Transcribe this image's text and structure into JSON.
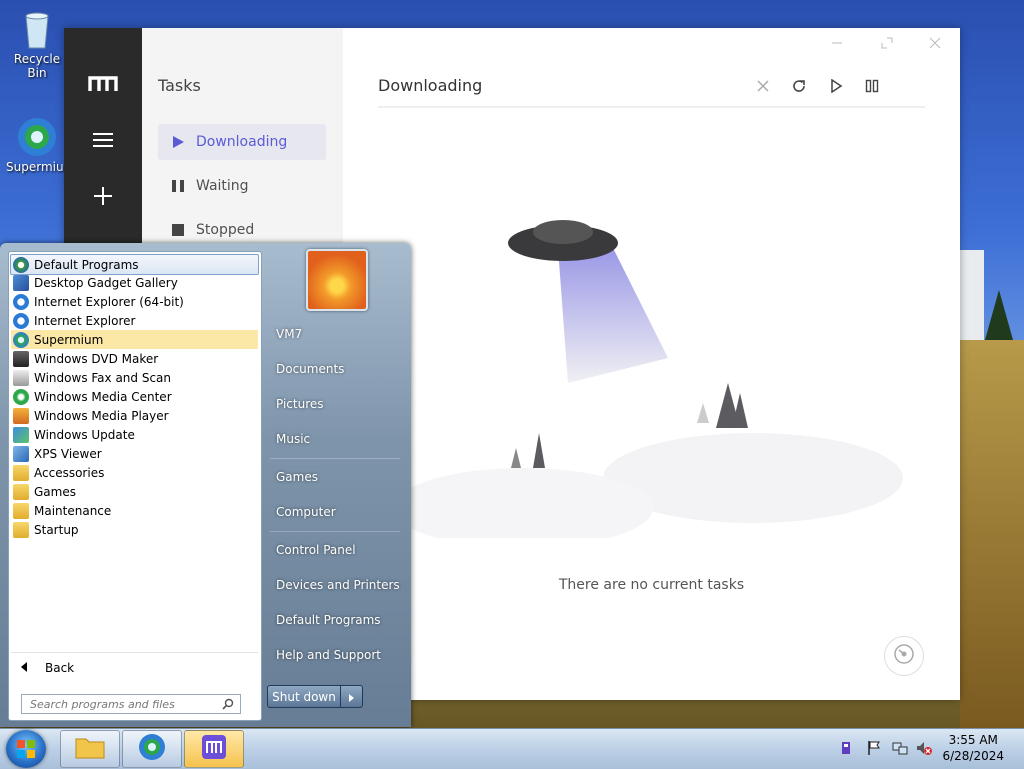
{
  "desktop": {
    "icons": [
      {
        "label": "Recycle Bin",
        "icon": "recycle-bin-icon"
      },
      {
        "label": "Supermium",
        "icon": "supermium-icon"
      }
    ]
  },
  "app": {
    "sidebar_title": "Tasks",
    "sidebar_items": [
      {
        "label": "Downloading",
        "icon": "play-icon"
      },
      {
        "label": "Waiting",
        "icon": "pause-icon"
      },
      {
        "label": "Stopped",
        "icon": "stop-icon"
      }
    ],
    "main_title": "Downloading",
    "toolbar": [
      "close-icon",
      "refresh-icon",
      "resume-icon",
      "pause-all-icon"
    ],
    "empty_message": "There are no current tasks",
    "accent_color": "#5b5bd6"
  },
  "start_menu": {
    "programs": [
      {
        "label": "Default Programs",
        "icon": "default-programs-icon"
      },
      {
        "label": "Desktop Gadget Gallery",
        "icon": "gadget-gallery-icon"
      },
      {
        "label": "Internet Explorer (64-bit)",
        "icon": "ie-icon"
      },
      {
        "label": "Internet Explorer",
        "icon": "ie-icon"
      },
      {
        "label": "Supermium",
        "icon": "supermium-icon"
      },
      {
        "label": "Windows DVD Maker",
        "icon": "dvd-maker-icon"
      },
      {
        "label": "Windows Fax and Scan",
        "icon": "fax-scan-icon"
      },
      {
        "label": "Windows Media Center",
        "icon": "media-center-icon"
      },
      {
        "label": "Windows Media Player",
        "icon": "media-player-icon"
      },
      {
        "label": "Windows Update",
        "icon": "windows-update-icon"
      },
      {
        "label": "XPS Viewer",
        "icon": "xps-viewer-icon"
      },
      {
        "label": "Accessories",
        "icon": "folder-icon"
      },
      {
        "label": "Games",
        "icon": "folder-icon"
      },
      {
        "label": "Maintenance",
        "icon": "folder-icon"
      },
      {
        "label": "Startup",
        "icon": "folder-icon"
      }
    ],
    "back_label": "Back",
    "search_placeholder": "Search programs and files",
    "right_items": [
      "VM7",
      "Documents",
      "Pictures",
      "Music",
      "Games",
      "Computer",
      "Control Panel",
      "Devices and Printers",
      "Default Programs",
      "Help and Support"
    ],
    "shutdown_label": "Shut down"
  },
  "taskbar": {
    "time": "3:55 AM",
    "date": "6/28/2024"
  }
}
